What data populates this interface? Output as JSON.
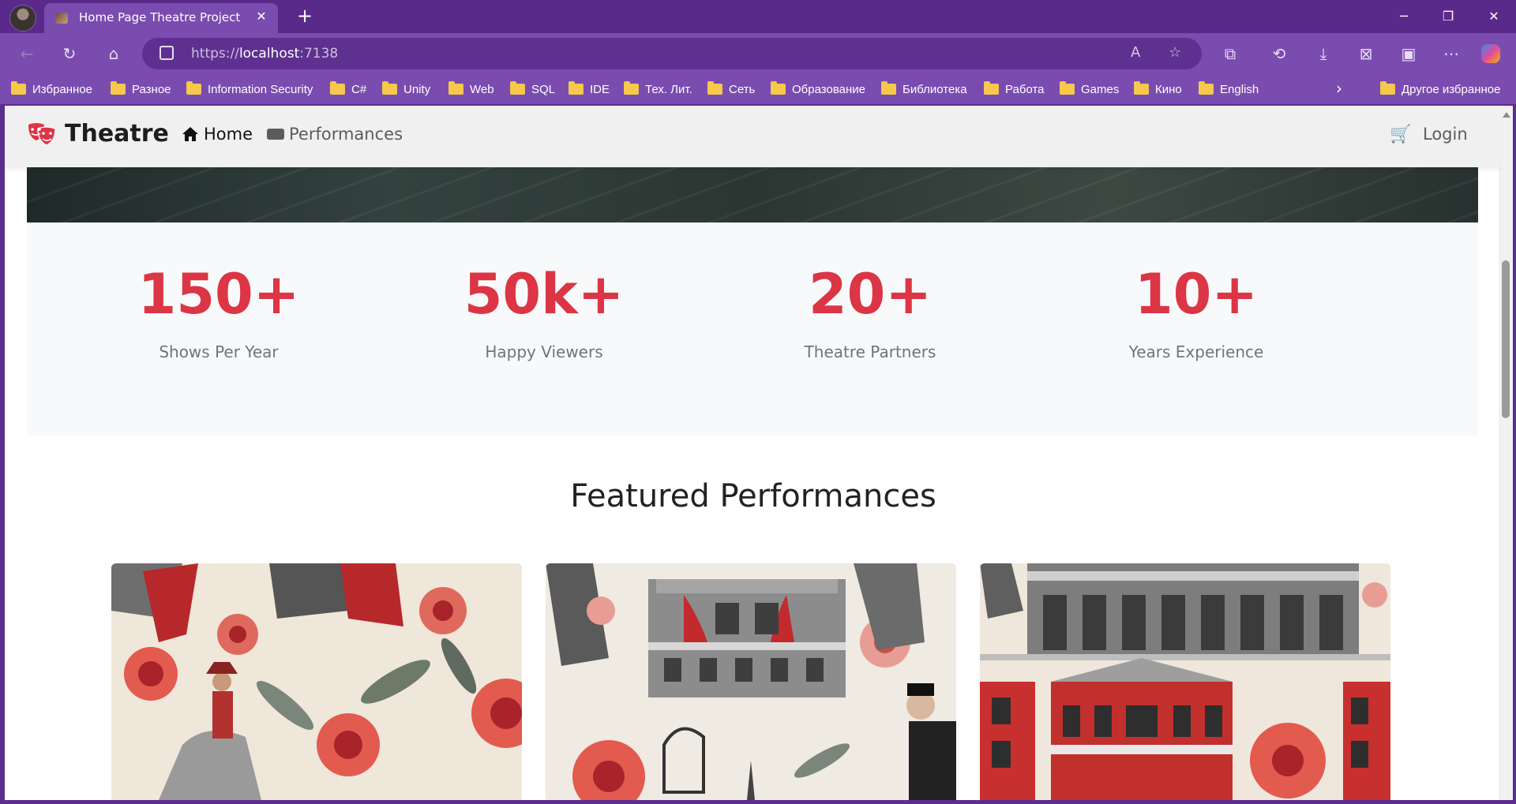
{
  "browser": {
    "tab_title": "Home Page Theatre Project",
    "url_scheme": "https://",
    "url_host": "localhost",
    "url_port": ":7138",
    "bookmarks": [
      "Избранное",
      "Разное",
      "Information Security",
      "C#",
      "Unity",
      "Web",
      "SQL",
      "IDE",
      "Тех. Лит.",
      "Сеть",
      "Образование",
      "Библиотека",
      "Работа",
      "Games",
      "Кино",
      "English"
    ],
    "other_bookmarks": "Другое избранное"
  },
  "navbar": {
    "brand": "Theatre",
    "home_label": "Home",
    "performances_label": "Performances",
    "login_label": "Login"
  },
  "stats": [
    {
      "value": "150+",
      "label": "Shows Per Year"
    },
    {
      "value": "50k+",
      "label": "Happy Viewers"
    },
    {
      "value": "20+",
      "label": "Theatre Partners"
    },
    {
      "value": "10+",
      "label": "Years Experience"
    }
  ],
  "featured": {
    "title": "Featured Performances"
  },
  "colors": {
    "accent": "#dc3545",
    "browser_frame": "#5a2a8a",
    "muted_text": "#6c757d"
  }
}
